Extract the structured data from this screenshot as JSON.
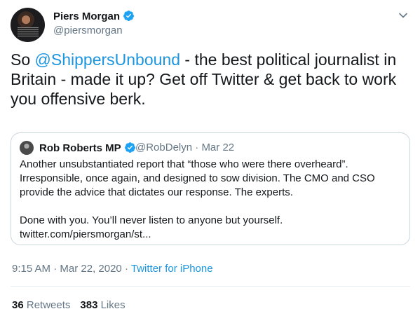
{
  "author": {
    "name": "Piers Morgan",
    "handle": "@piersmorgan"
  },
  "tweet": {
    "prefix": "So ",
    "mention": "@ShippersUnbound",
    "line1_rest": " - the best political journalist in",
    "line2": "Britain - made it up? Get off Twitter & get back to work",
    "line3": "you offensive berk."
  },
  "quoted": {
    "name": "Rob Roberts MP",
    "handle": "@RobDelyn",
    "separator": "·",
    "date": "Mar 22",
    "paragraph1_lines": [
      "Another unsubstantiated report that “those who were there overheard”.",
      "Irresponsible, once again, and designed to sow division. The CMO and CSO",
      "provide the advice that dictates our response. The experts."
    ],
    "paragraph2_lines": [
      "Done with you. You’ll never listen to anyone but yourself.",
      "twitter.com/piersmorgan/st..."
    ]
  },
  "meta": {
    "time": "9:15 AM",
    "separator1": "·",
    "date": "Mar 22, 2020",
    "separator2": "·",
    "source": "Twitter for iPhone"
  },
  "stats": {
    "retweets_count": "36",
    "retweets_label": "Retweets",
    "likes_count": "383",
    "likes_label": "Likes"
  },
  "colors": {
    "link": "#1b95e0",
    "verified": "#1da1f2",
    "secondary_text": "#657786",
    "border": "#ccd6dd"
  },
  "icons": {
    "verified": "verified-badge-icon",
    "menu": "chevron-down-icon"
  }
}
